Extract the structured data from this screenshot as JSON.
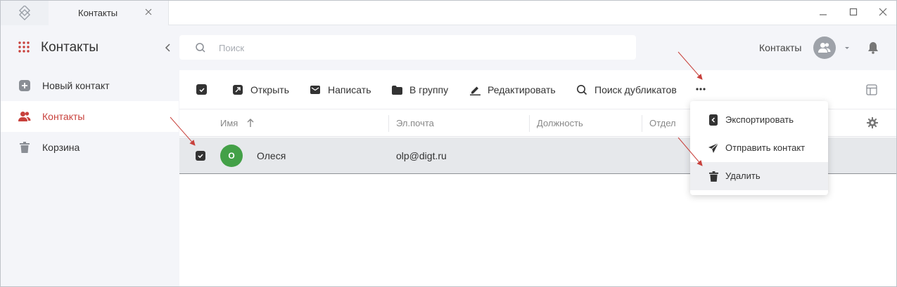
{
  "titlebar": {
    "tab_label": "Контакты"
  },
  "sidebar": {
    "title": "Контакты",
    "items": [
      {
        "label": "Новый контакт",
        "icon": "plus-square-icon"
      },
      {
        "label": "Контакты",
        "icon": "users-icon",
        "active": true
      },
      {
        "label": "Корзина",
        "icon": "trash-icon"
      }
    ]
  },
  "search": {
    "placeholder": "Поиск"
  },
  "account": {
    "label": "Контакты"
  },
  "toolbar": {
    "open": "Открыть",
    "write": "Написать",
    "to_group": "В группу",
    "edit": "Редактировать",
    "find_duplicates": "Поиск дубликатов"
  },
  "table": {
    "columns": [
      "Имя",
      "Эл.почта",
      "Должность",
      "Отдел"
    ],
    "rows": [
      {
        "initial": "О",
        "name": "Олеся",
        "email": "olp@digt.ru",
        "selected": true
      }
    ]
  },
  "menu": {
    "items": [
      {
        "label": "Экспортировать",
        "icon": "export-icon"
      },
      {
        "label": "Отправить контакт",
        "icon": "send-icon"
      },
      {
        "label": "Удалить",
        "icon": "trash-icon"
      }
    ]
  },
  "colors": {
    "accent": "#c8413c",
    "avatar_green": "#43a047",
    "annotation_red": "#c8413c"
  }
}
